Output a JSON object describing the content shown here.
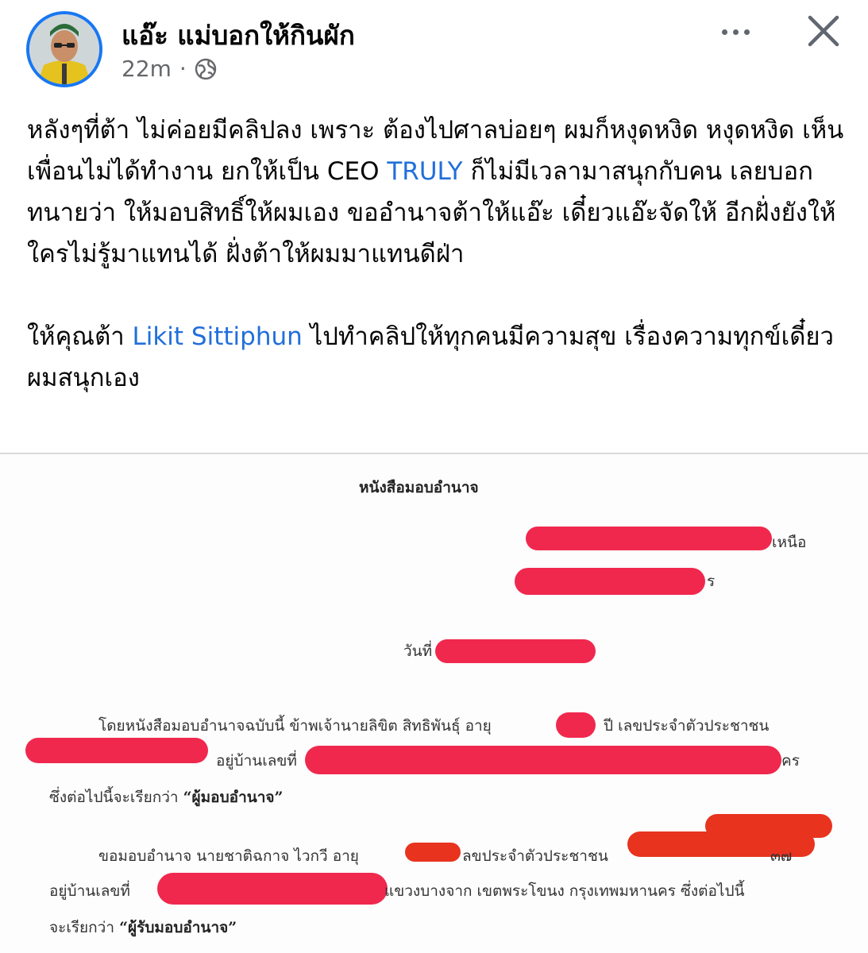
{
  "post": {
    "author": "แอ๊ะ แม่บอกให้กินผัก",
    "timestamp": "22m",
    "separator": "·",
    "audience_icon": "globe-icon",
    "more_icon": "more-dots-icon",
    "close_icon": "close-icon",
    "paragraph1": {
      "before_link": "หลังๆที่ต้า ไม่ค่อยมีคลิปลง เพราะ ต้องไปศาลบ่อยๆ ผมก็หงุดหงิด หงุดหงิด เห็นเพื่อนไม่ได้ทำงาน  ยกให้เป็น CEO ",
      "link": "TRULY",
      "after_link": " ก็ไม่มีเวลามาสนุกกับคน เลยบอกทนายว่า ให้มอบสิทธิ์ให้ผมเอง ขออำนาจต้าให้แอ๊ะ เดี๋ยวแอ๊ะจัดให้ อีกฝั่งยังให้ใครไม่รู้มาแทนได้ ฝั่งต้าให้ผมมาแทนดีฝ่า"
    },
    "paragraph2": {
      "before_link": "ให้คุณต้า ",
      "link": "Likit Sittiphun",
      "after_link": " ไปทำคลิปให้ทุกคนมีความสุข เรื่องความทุกข์เดี๋ยวผมสนุกเอง"
    }
  },
  "document": {
    "title": "หนังสือมอบอำนาจ",
    "addr1_tail": "เหนือ",
    "addr2_tail": "ร",
    "date_label": "วันที่",
    "para1_line1": "โดยหนังสือมอบอำนาจฉบับนี้ ข้าพเจ้านายลิขิต สิทธิพันธุ์ อายุ",
    "para1_line1b": "ปี เลขประจำตัวประชาชน",
    "para1_line2": "อยู่บ้านเลขที่",
    "para1_line2_tail": "คร",
    "para1_line3_prefix": "ซึ่งต่อไปนี้จะเรียกว่า",
    "grantor": "“ผู้มอบอำนาจ”",
    "para2_line1a": "ขอมอบอำนาจ นายชาติฉกาจ ไวกวี อายุ",
    "para2_line1b": "ลขประจำตัวประชาชน",
    "para2_line1_tail": "๓๗",
    "para2_line2a": "อยู่บ้านเลขที่",
    "para2_line2b": "แขวงบางจาก เขตพระโขนง กรุงเทพมหานคร ซึ่งต่อไปนี้",
    "para2_line3_prefix": "จะเรียกว่า",
    "grantee": "“ผู้รับมอบอำนาจ”"
  },
  "colors": {
    "link": "#216fdb",
    "avatar_ring": "#1877f2",
    "redaction": "#f0284e",
    "redaction_alt": "#e8331f"
  }
}
